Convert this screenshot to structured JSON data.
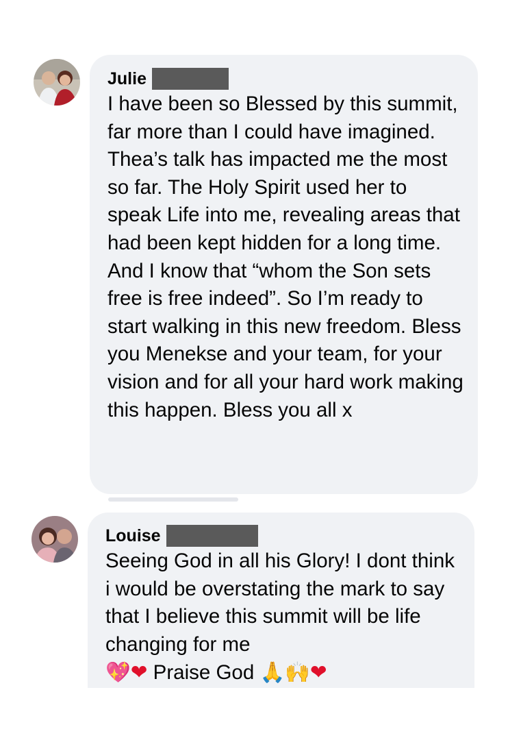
{
  "comments": [
    {
      "author": "Julie",
      "text": "I have been so Blessed by this summit, far more than I could have imagined. Thea’s talk has impacted me the most so far. The Holy Spirit used her to speak Life into me, revealing areas that had been kept hidden for a long time. And I know that “whom the Son sets free is free indeed”. So I’m ready to start walking in this new freedom. Bless you Menekse and your team, for your vision and for all your hard work making this happen. Bless you all x"
    },
    {
      "author": "Louise",
      "text": "Seeing God in all his Glory! I dont think i would be overstating the mark to say that I believe this summit will be life changing for me",
      "text_end": "Praise God",
      "emojis_before": [
        "sparkling-heart",
        "red-heart"
      ],
      "emojis_after": [
        "folded-hands",
        "raising-hands",
        "red-heart"
      ]
    }
  ],
  "emoji_glyphs": {
    "sparkling_heart": "💖",
    "red_heart": "❤",
    "folded_hands": "🙏",
    "raising_hands": "🙌"
  }
}
